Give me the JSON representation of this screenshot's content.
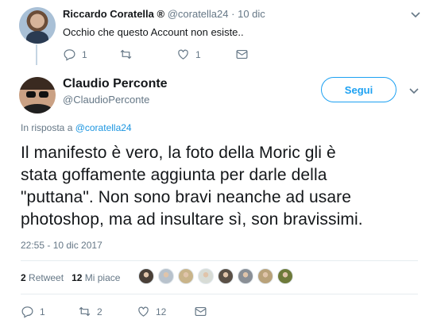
{
  "parent_tweet": {
    "name": "Riccardo Coratella ®",
    "handle": "@coratella24",
    "separator": "·",
    "date": "10 dic",
    "text": "Occhio che questo Account non esiste..",
    "replies": "1",
    "retweets": "",
    "likes": "1"
  },
  "main_tweet": {
    "name": "Claudio Perconte",
    "handle": "@ClaudioPerconte",
    "follow_label": "Segui",
    "reply_prefix": "In risposta a ",
    "reply_handle": "@coratella24",
    "text_lines": [
      "Il manifesto è vero, la foto della Moric gli è",
      "stata goffamente aggiunta per darle della",
      "\"puttana\". Non sono bravi neanche ad usare",
      "photoshop, ma ad insultare sì, son bravissimi."
    ],
    "timestamp": "22:55 - 10 dic 2017",
    "retweet_count": "2",
    "retweet_label": "Retweet",
    "like_count": "12",
    "like_label": "Mi piace",
    "replies": "1",
    "retweets": "2",
    "likes": "12"
  },
  "liker_avatar_colors": [
    "#4a4038",
    "#b8c2cc",
    "#c9b48a",
    "#d8dcd6",
    "#5a5046",
    "#8a8f96",
    "#b9a27a",
    "#6e7a3a"
  ],
  "colors": {
    "accent": "#1da1f2",
    "link": "#1b95e0",
    "secondary_text": "#657786"
  },
  "icons": [
    "reply-icon",
    "retweet-icon",
    "heart-icon",
    "envelope-icon",
    "chevron-down-icon"
  ]
}
